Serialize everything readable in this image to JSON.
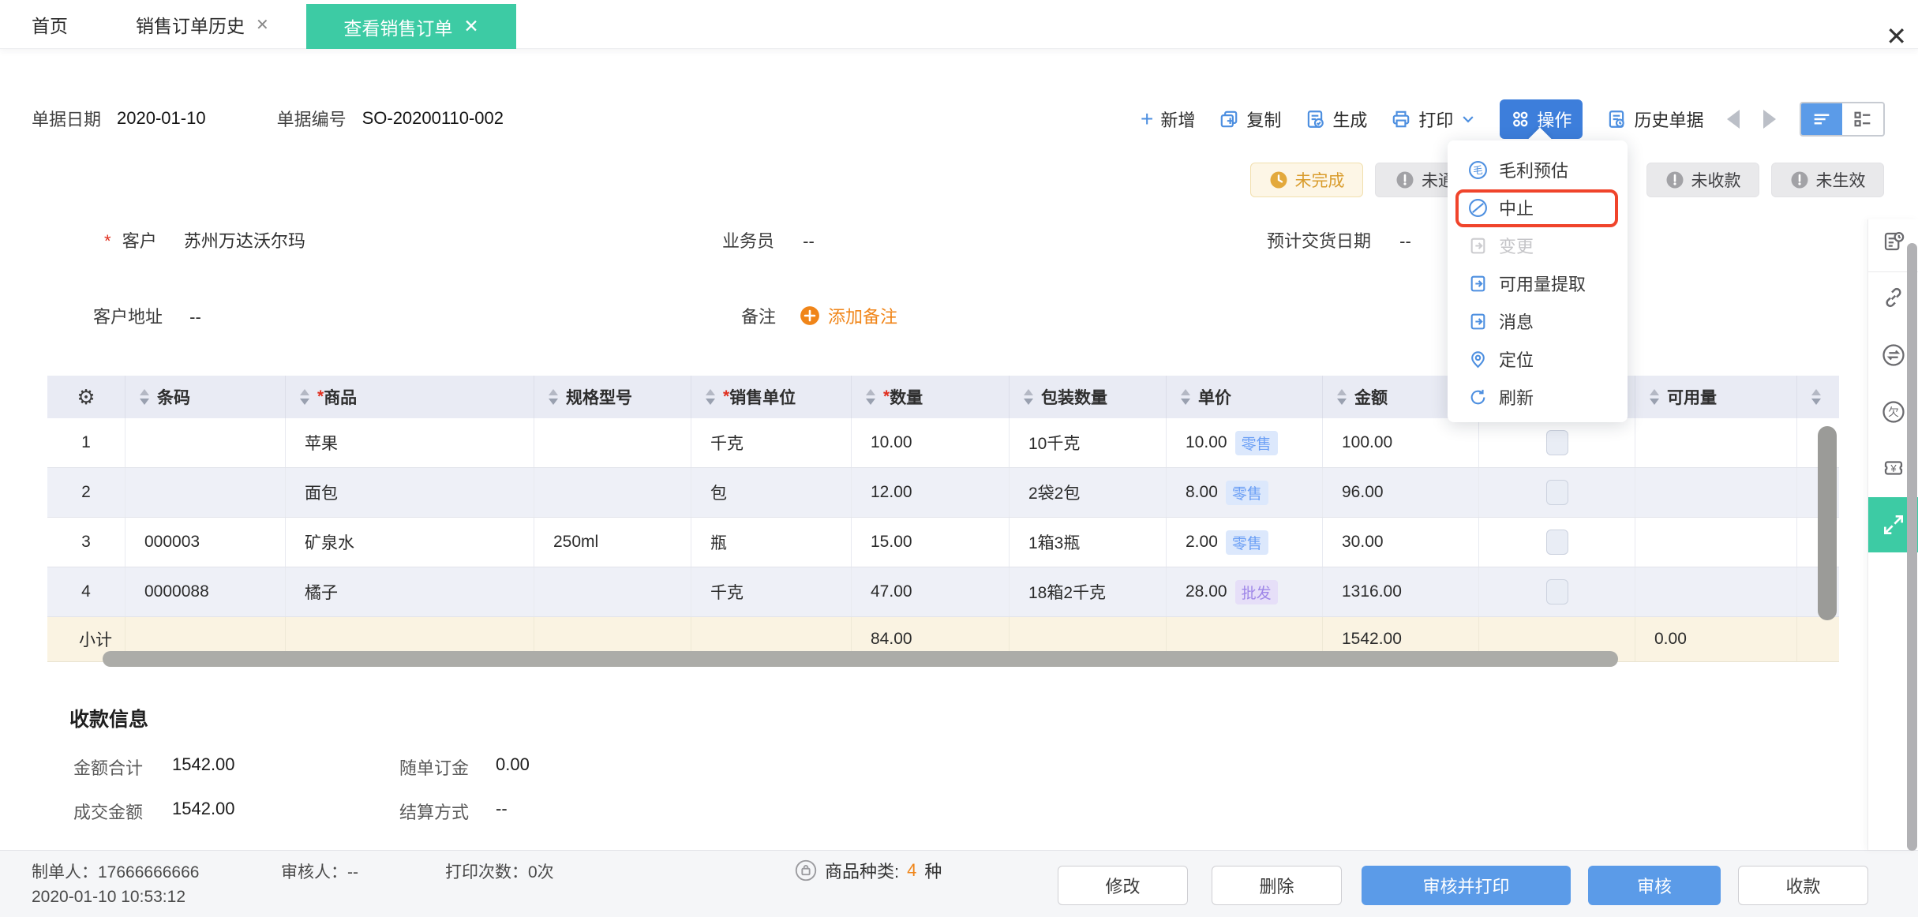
{
  "tabs": [
    {
      "label": "首页",
      "active": false,
      "closable": false
    },
    {
      "label": "销售订单历史",
      "active": false,
      "closable": true
    },
    {
      "label": "查看销售订单",
      "active": true,
      "closable": true
    }
  ],
  "header": {
    "date_label": "单据日期",
    "date": "2020-01-10",
    "no_label": "单据编号",
    "no": "SO-20200110-002"
  },
  "toolbar": {
    "add": "新增",
    "copy": "复制",
    "generate": "生成",
    "print": "打印",
    "action": "操作",
    "history": "历史单据"
  },
  "badges": [
    {
      "label": "未完成",
      "type": "warning"
    },
    {
      "label": "未通知",
      "type": "gray"
    },
    {
      "label": "未收款",
      "type": "gray"
    },
    {
      "label": "未生效",
      "type": "gray"
    }
  ],
  "menu": {
    "items": [
      {
        "label": "毛利预估",
        "state": "normal"
      },
      {
        "label": "中止",
        "state": "highlighted"
      },
      {
        "label": "变更",
        "state": "disabled"
      },
      {
        "label": "可用量提取",
        "state": "normal"
      },
      {
        "label": "消息",
        "state": "normal"
      },
      {
        "label": "定位",
        "state": "normal"
      },
      {
        "label": "刷新",
        "state": "normal"
      }
    ]
  },
  "form": {
    "required_mark": "*",
    "customer_label": "客户",
    "customer": "苏州万达沃尔玛",
    "salesman_label": "业务员",
    "salesman": "--",
    "delivery_label": "预计交货日期",
    "delivery": "--",
    "address_label": "客户地址",
    "address": "--",
    "remark_label": "备注",
    "add_remark": "添加备注"
  },
  "table": {
    "headers": [
      "条码",
      "商品",
      "规格型号",
      "销售单位",
      "数量",
      "包装数量",
      "单价",
      "金额",
      "可用量"
    ],
    "rows": [
      {
        "no": "1",
        "barcode": "",
        "product": "苹果",
        "spec": "",
        "unit": "千克",
        "qty": "10.00",
        "pkg": "10千克",
        "price": "10.00",
        "tag": "零售",
        "amount": "100.00",
        "available": ""
      },
      {
        "no": "2",
        "barcode": "",
        "product": "面包",
        "spec": "",
        "unit": "包",
        "qty": "12.00",
        "pkg": "2袋2包",
        "price": "8.00",
        "tag": "零售",
        "amount": "96.00",
        "available": ""
      },
      {
        "no": "3",
        "barcode": "000003",
        "product": "矿泉水",
        "spec": "250ml",
        "unit": "瓶",
        "qty": "15.00",
        "pkg": "1箱3瓶",
        "price": "2.00",
        "tag": "零售",
        "amount": "30.00",
        "available": ""
      },
      {
        "no": "4",
        "barcode": "0000088",
        "product": "橘子",
        "spec": "",
        "unit": "千克",
        "qty": "47.00",
        "pkg": "18箱2千克",
        "price": "28.00",
        "tag": "批发",
        "amount": "1316.00",
        "available": ""
      }
    ],
    "subtotal": {
      "label": "小计",
      "qty": "84.00",
      "amount": "1542.00",
      "available": "0.00"
    }
  },
  "payment": {
    "title": "收款信息",
    "total_label": "金额合计",
    "total": "1542.00",
    "deposit_label": "随单订金",
    "deposit": "0.00",
    "deal_label": "成交金额",
    "deal": "1542.00",
    "settle_label": "结算方式",
    "settle": "--"
  },
  "footer": {
    "creator_label": "制单人：",
    "creator": "17666666666",
    "created_at": "2020-01-10 10:53:12",
    "auditor_label": "审核人：",
    "auditor": "--",
    "print_label": "打印次数：",
    "print_count": "0次",
    "sku_label": "商品种类:",
    "sku_count": "4",
    "sku_unit": "种",
    "buttons": [
      {
        "label": "修改",
        "style": "plain"
      },
      {
        "label": "删除",
        "style": "plain"
      },
      {
        "label": "审核并打印",
        "style": "primary"
      },
      {
        "label": "审核",
        "style": "primary"
      },
      {
        "label": "收款",
        "style": "plain"
      }
    ]
  },
  "colors": {
    "active_tab_teal": "#3DCBA4",
    "action_button_blue": "#3D7EDB",
    "primary_button_blue": "#5B9BE8",
    "toolbar_icon_blue": "#4D8FE0",
    "highlight_red": "#F0442B",
    "warning_badge_text": "#D99C2C",
    "orange_accent": "#F08519",
    "retail_tag_blue": "#6B9FF5",
    "wholesale_tag_purple": "#9F87E8",
    "subtotal_cream": "#FAF3E2",
    "table_header_bg": "#E9EBF4"
  }
}
